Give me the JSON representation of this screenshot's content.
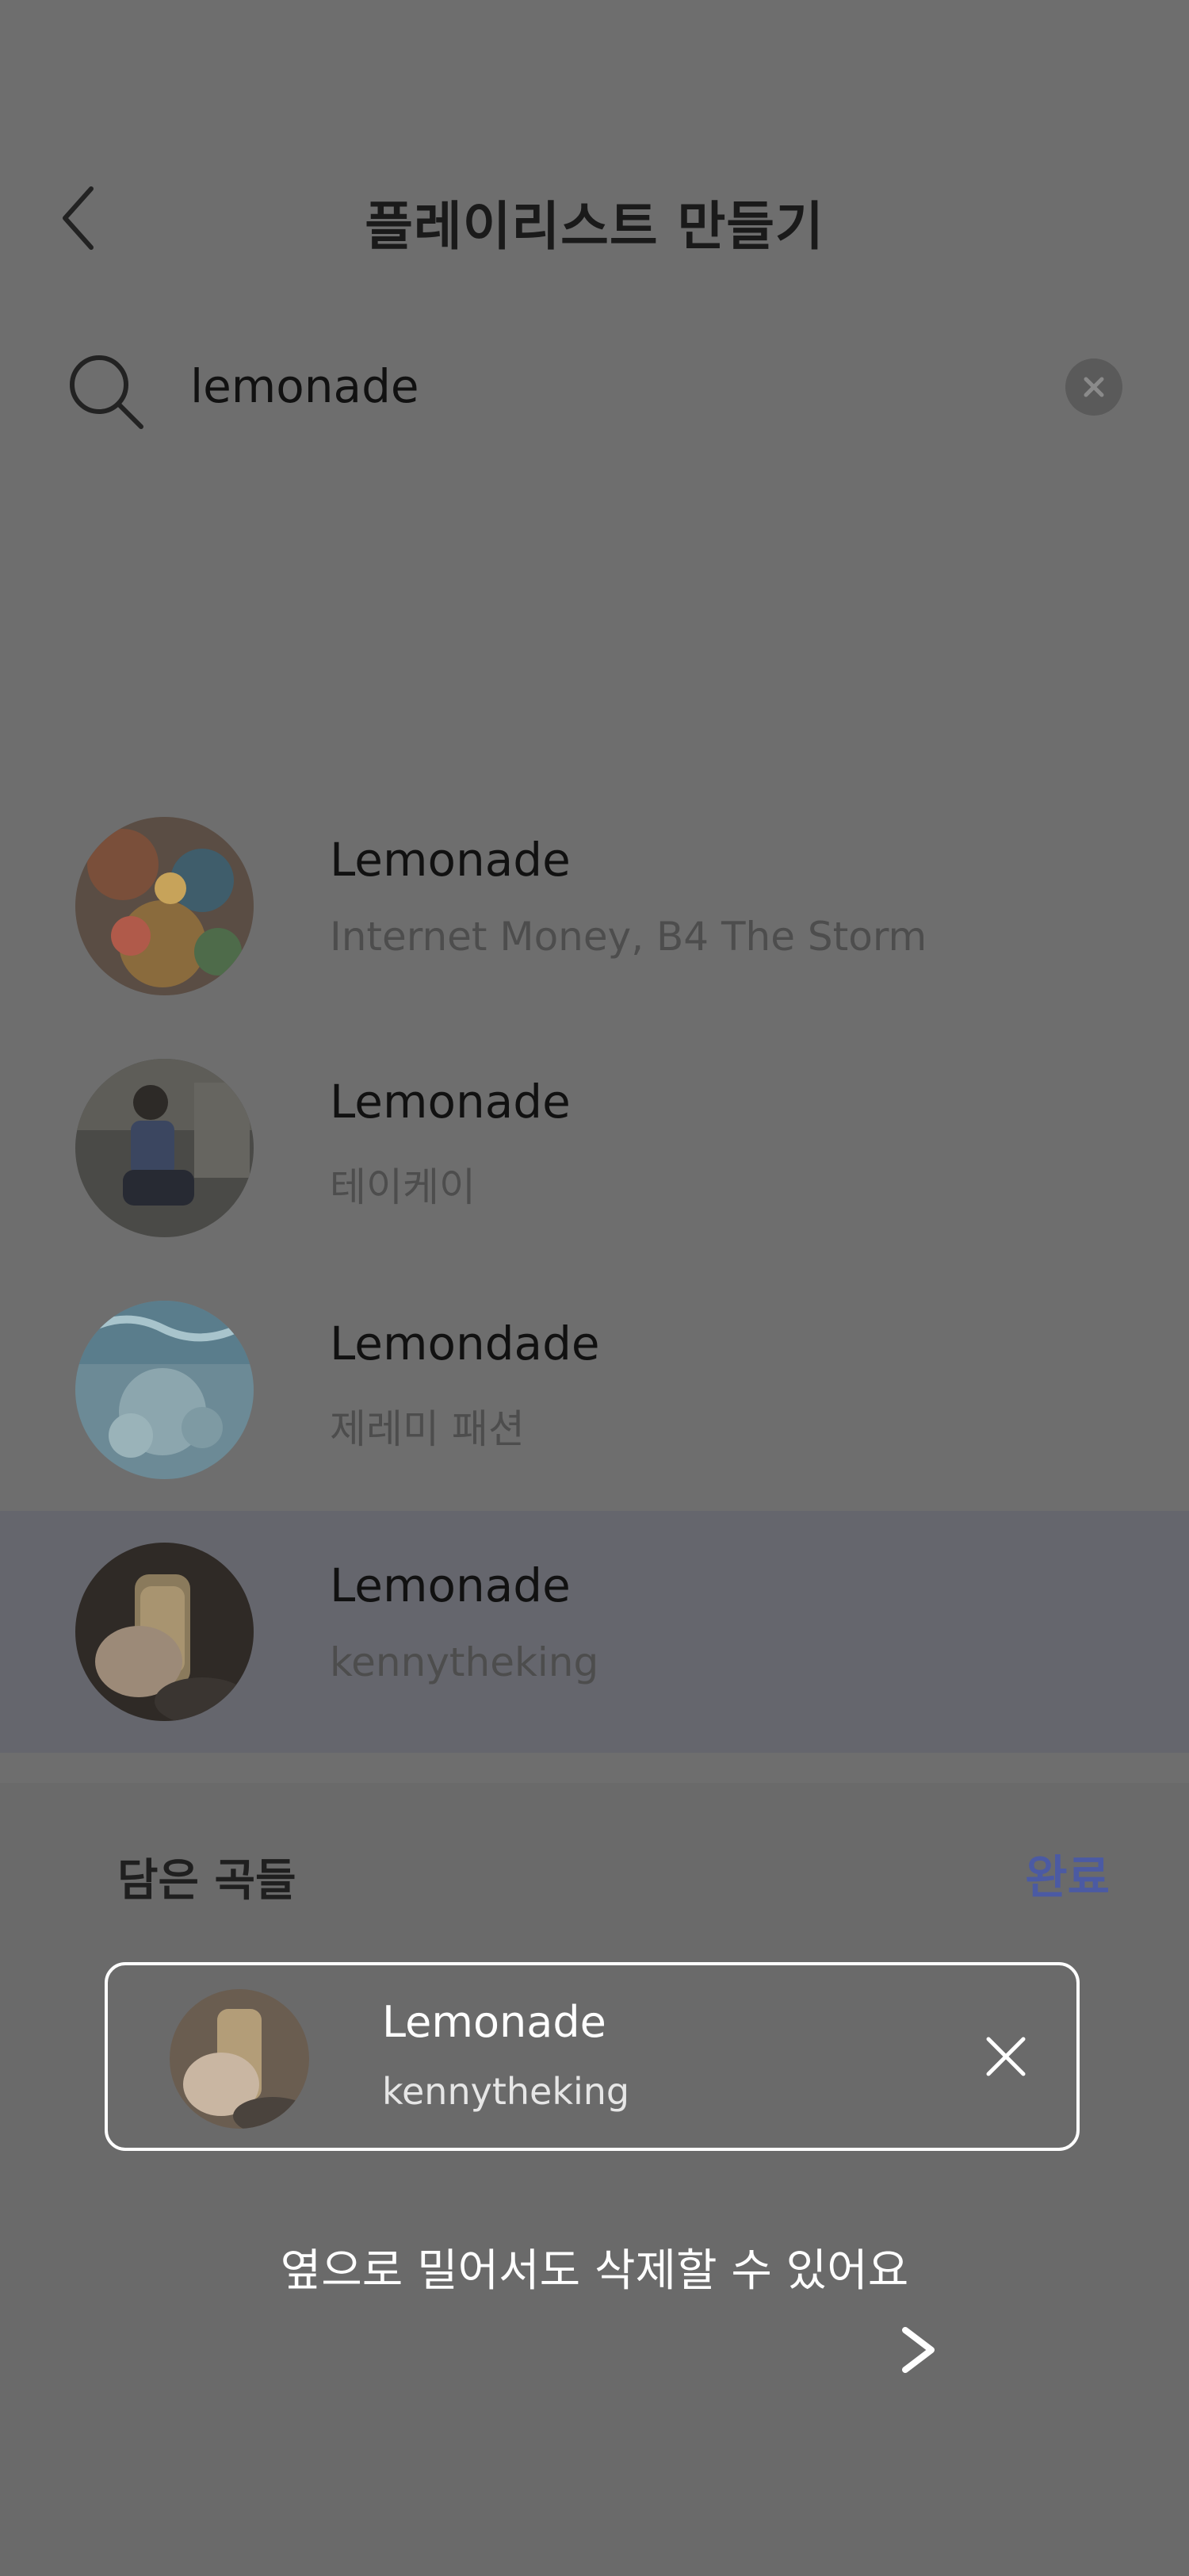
{
  "header": {
    "title": "플레이리스트 만들기",
    "back_icon": "chevron-left-icon"
  },
  "search": {
    "value": "lemonade",
    "search_icon": "search-icon",
    "clear_icon": "clear-circle-icon"
  },
  "results": [
    {
      "title": "Lemonade",
      "artist": "Internet Money, B4 The Storm",
      "highlighted": false
    },
    {
      "title": "Lemonade",
      "artist": "테이케이",
      "highlighted": false
    },
    {
      "title": "Lemondade",
      "artist": "제레미 패션",
      "highlighted": false
    },
    {
      "title": "Lemonade",
      "artist": "kennytheking",
      "highlighted": true
    }
  ],
  "sheet": {
    "title": "담은 곡들",
    "done_label": "완료",
    "picked": {
      "title": "Lemonade",
      "artist": "kennytheking",
      "remove_icon": "close-icon"
    },
    "hint": "옆으로 밀어서도 삭제할 수 있어요",
    "hint_icon": "arrow-right-icon"
  },
  "colors": {
    "overlay": "#6e6e6e",
    "highlight_row": "#65666d",
    "accent": "#4b5aa3"
  }
}
